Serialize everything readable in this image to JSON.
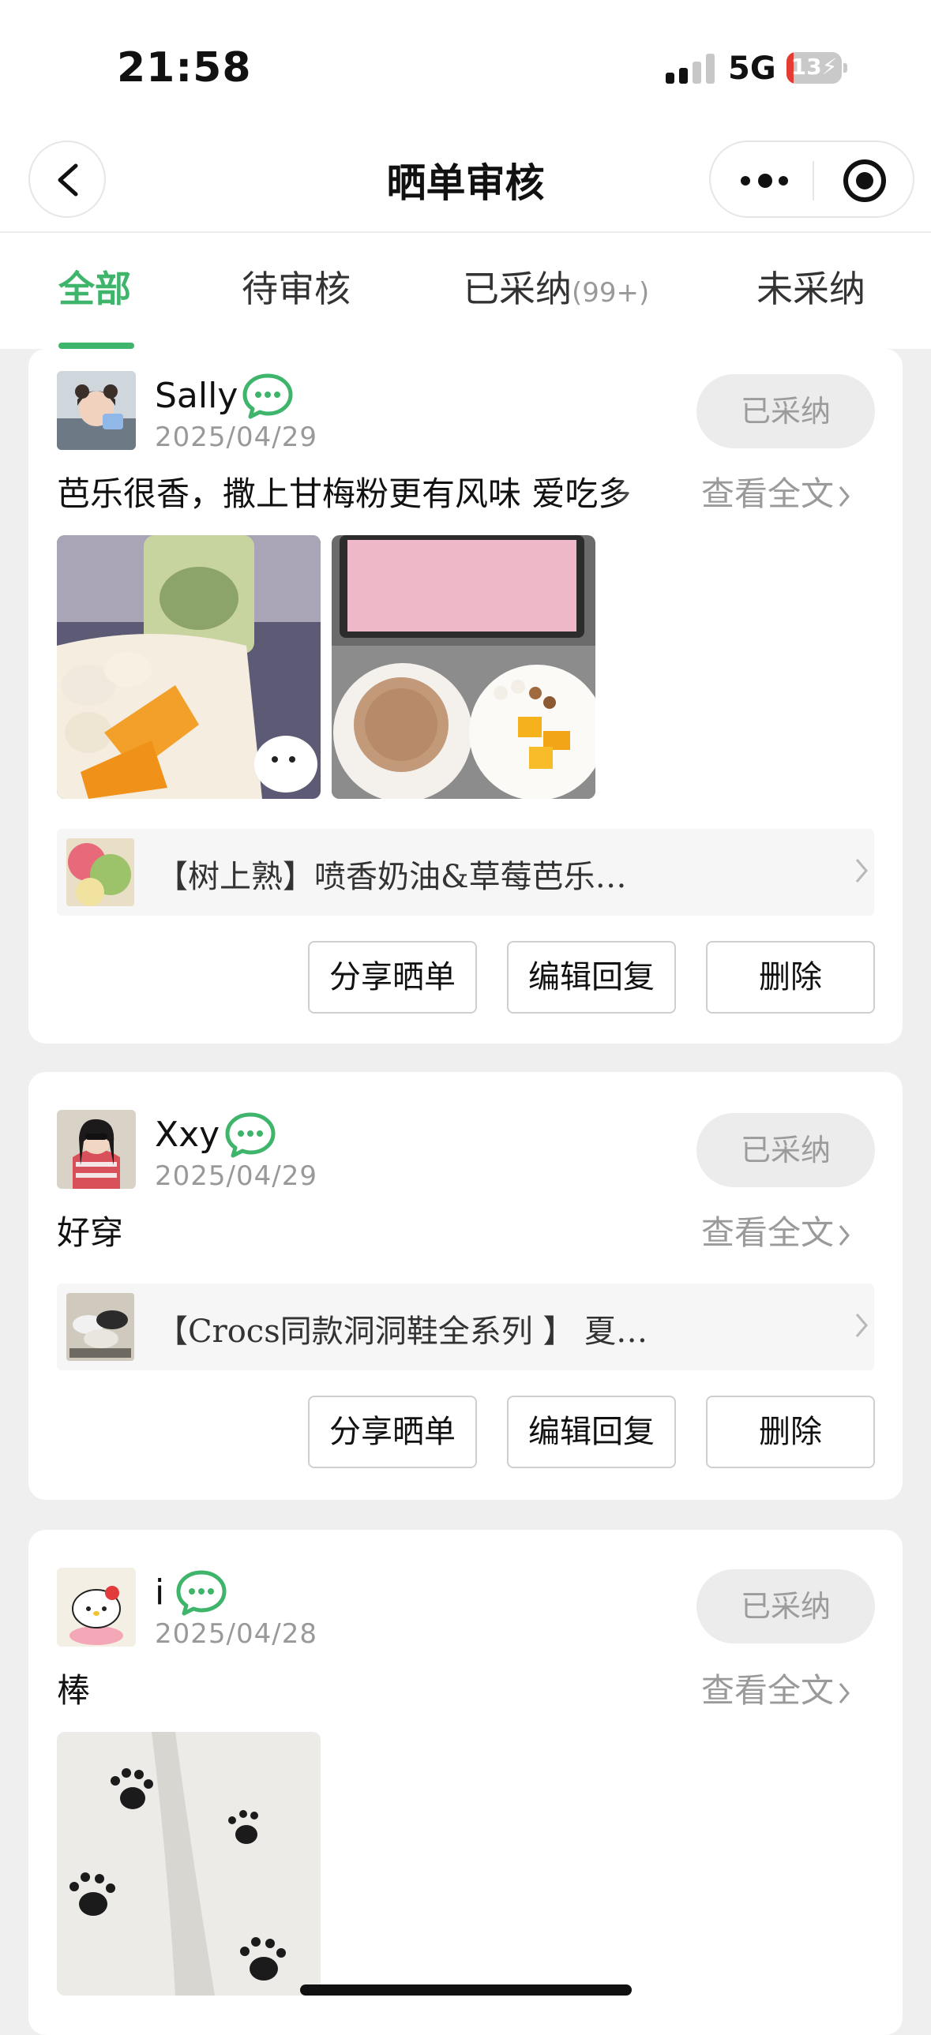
{
  "status_bar": {
    "time": "21:58",
    "network": "5G",
    "battery": "13",
    "battery_level": 0.13
  },
  "nav": {
    "title": "晒单审核"
  },
  "tabs": [
    {
      "label": "全部",
      "badge": ""
    },
    {
      "label": "待审核",
      "badge": ""
    },
    {
      "label": "已采纳",
      "badge": "(99+)"
    },
    {
      "label": "未采纳",
      "badge": ""
    }
  ],
  "reviews": [
    {
      "user": "Sally",
      "date": "2025/04/29",
      "status": "已采纳",
      "content": "芭乐很香，撒上甘梅粉更有风味 爱吃多",
      "read_more": "查看全文",
      "product": "【树上熟】喷香奶油&草莓芭乐…",
      "actions": {
        "share": "分享晒单",
        "edit": "编辑回复",
        "delete": "删除"
      }
    },
    {
      "user": "Xxy",
      "date": "2025/04/29",
      "status": "已采纳",
      "content": "好穿",
      "read_more": "查看全文",
      "product": "【Crocs同款洞洞鞋全系列 】 夏…",
      "actions": {
        "share": "分享晒单",
        "edit": "编辑回复",
        "delete": "删除"
      }
    },
    {
      "user": "i",
      "date": "2025/04/28",
      "status": "已采纳",
      "content": "棒",
      "read_more": "查看全文"
    }
  ],
  "colors": {
    "accent": "#3fb56c",
    "page_bg": "#efefef",
    "pill_bg": "#ececec",
    "muted": "#999999"
  },
  "icons": [
    "back-arrow-icon",
    "more-icon",
    "target-icon",
    "wechat-bubble-icon",
    "chevron-right-icon"
  ]
}
